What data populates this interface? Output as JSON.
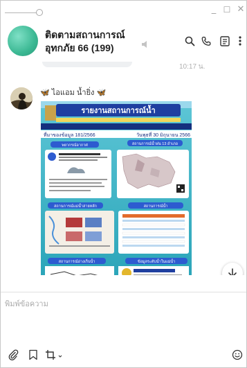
{
  "window": {
    "minimize_glyph": "_",
    "maximize_glyph": "☐",
    "close_glyph": "✕"
  },
  "header": {
    "title": "ติดตามสถานการณ์อุทกภัย 66 (199)",
    "icons": [
      "mute-icon",
      "search-icon",
      "call-icon",
      "notes-icon",
      "more-icon"
    ]
  },
  "chat": {
    "previous_time": "10:17 น.",
    "message": {
      "sender": "🦋 ไอแอม น้ำยิ่ง 🦋",
      "image": {
        "headline": "รายงานสถานการณ์น้ำ",
        "date_left": "ที่มาของข้อมูล 181/2566",
        "date_right": "วันพุธที่ 30 มิถุนายน 2566",
        "sections": [
          "พยากรณ์อากาศ",
          "สถานการณ์น้ำฝน 13 อำเภอ",
          "สถานการณ์แม่น้ำสายหลัก",
          "สถานการณ์น้ำ",
          "สถานการณ์อ่างเก็บน้ำ",
          "ข้อมูลระดับน้ำในแม่น้ำ"
        ]
      }
    }
  },
  "composer": {
    "placeholder": "พิมพ์ข้อความ",
    "value": ""
  },
  "colors": {
    "accent": "#3bb893",
    "card_bg": "#38b6c8",
    "banner": "#1f3fa0"
  }
}
